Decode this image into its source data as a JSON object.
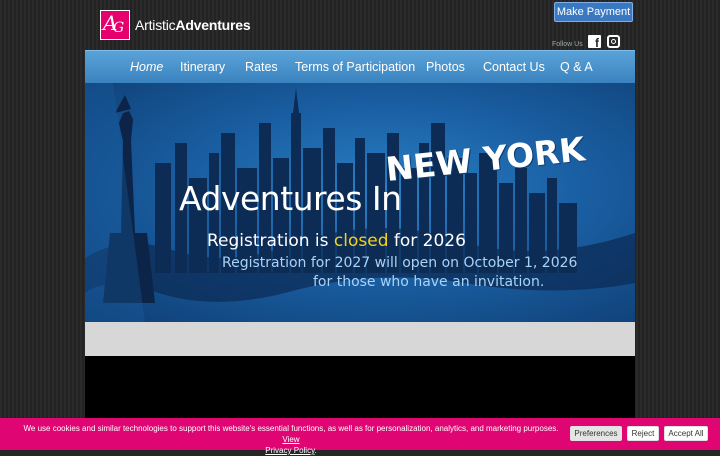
{
  "header": {
    "logo_text_1": "Artistic",
    "logo_text_2": "Adventures",
    "logo_mark": "AA",
    "make_payment": "Make Payment",
    "follow_us": "Follow Us",
    "social_icons": [
      "facebook-icon",
      "instagram-icon"
    ]
  },
  "nav": {
    "items": [
      {
        "label": "Home",
        "active": true
      },
      {
        "label": "Itinerary"
      },
      {
        "label": "Rates"
      },
      {
        "label": "Terms of Participation"
      },
      {
        "label": "Photos"
      },
      {
        "label": "Contact Us"
      },
      {
        "label": "Q & A"
      }
    ]
  },
  "banner": {
    "title": "Adventures In",
    "title_strong": "NEW YORK",
    "reg_pre": "Registration is",
    "reg_closed": "closed",
    "reg_post": "for 2026",
    "next_line": "Registration for 2027 will open on October 1, 2026",
    "invite_line": "for those who have an invitation."
  },
  "cookie": {
    "text": "We use cookies and similar technologies to support this website's essential functions, as well as for personalization, analytics, and marketing purposes.",
    "link_1": "View",
    "link_2": "Privacy Policy",
    "preferences": "Preferences",
    "reject": "Reject",
    "accept_all": "Accept All"
  },
  "colors": {
    "accent": "#e6006e",
    "nav_blue": "#4a94cc",
    "highlight_yellow": "#f6d21b",
    "cookie_bg": "#df0674"
  }
}
